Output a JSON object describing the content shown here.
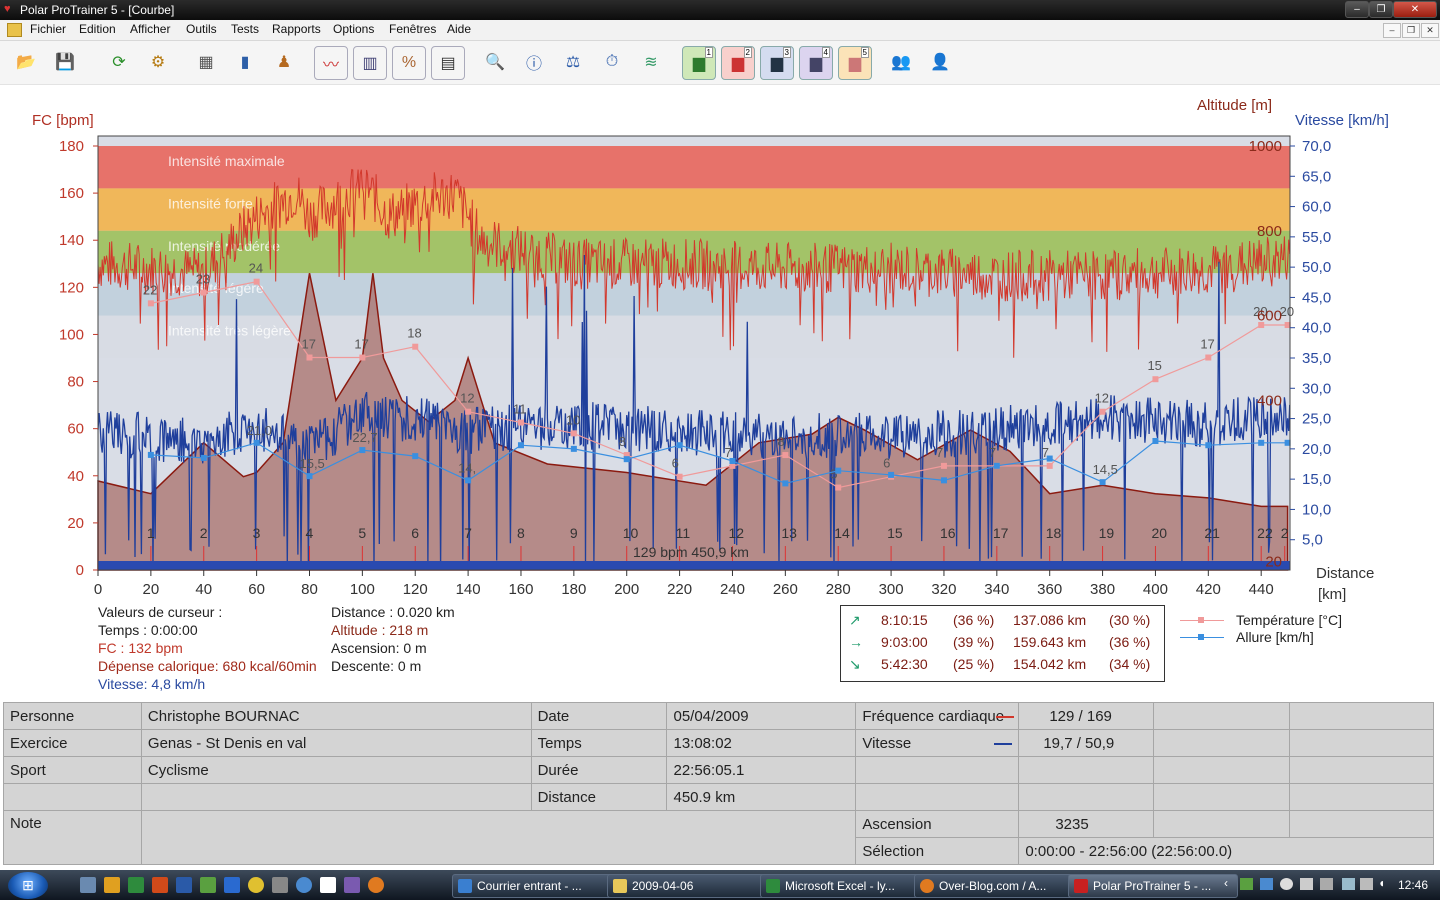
{
  "window": {
    "title": "Polar ProTrainer 5 - [Courbe]",
    "app_icon": "polar-heart-icon"
  },
  "menu": [
    "Fichier",
    "Edition",
    "Afficher",
    "Outils",
    "Tests",
    "Rapports",
    "Options",
    "Fenêtres",
    "Aide"
  ],
  "toolbar": {
    "buttons": [
      "open-folder-icon",
      "save-disk-icon",
      "sync-icon",
      "settings-gear-icon",
      "calendar-icon",
      "book-icon",
      "person-tip-icon",
      "line-chart-icon",
      "bar-chart-icon",
      "percent-chart-icon",
      "table-icon",
      "zoom-icon",
      "info-chart-icon",
      "weight-icon",
      "stopwatch-icon",
      "multi-line-icon",
      "chart-1-icon",
      "chart-2-icon",
      "chart-3-icon",
      "chart-4-icon",
      "chart-5-icon",
      "group-report-icon",
      "users-icon"
    ],
    "chart_numbers": [
      "1",
      "2",
      "3",
      "4",
      "5"
    ]
  },
  "chart_data": {
    "type": "line",
    "axes": {
      "left_label": "FC [bpm]",
      "left_ticks": [
        "0",
        "20",
        "40",
        "60",
        "80",
        "100",
        "120",
        "140",
        "160",
        "180"
      ],
      "right1_label": "Altitude  [m]",
      "right1_ticks": [
        "20",
        "400",
        "600",
        "800",
        "1000"
      ],
      "right2_label": "Vitesse [km/h]",
      "right2_ticks": [
        "5,0",
        "10,0",
        "15,0",
        "20,0",
        "25,0",
        "30,0",
        "35,0",
        "40,0",
        "45,0",
        "50,0",
        "55,0",
        "60,0",
        "65,0",
        "70,0"
      ],
      "x_label_line1": "Distance",
      "x_label_line2": "[km]",
      "x_ticks": [
        "0",
        "20",
        "40",
        "60",
        "80",
        "100",
        "120",
        "140",
        "160",
        "180",
        "200",
        "220",
        "240",
        "260",
        "280",
        "300",
        "320",
        "340",
        "360",
        "380",
        "400",
        "420",
        "440"
      ],
      "xlim": [
        0,
        450.9
      ],
      "ylim_hr": [
        0,
        180
      ],
      "ylim_speed": [
        0,
        70
      ],
      "ylim_alt": [
        0,
        1000
      ]
    },
    "zones": [
      {
        "label": "Intensité maximale",
        "from": 162,
        "to": 180,
        "color": "#e8665c"
      },
      {
        "label": "Intensité forte",
        "from": 144,
        "to": 162,
        "color": "#f2b24a"
      },
      {
        "label": "Intensité modérée",
        "from": 126,
        "to": 144,
        "color": "#9cc05a"
      },
      {
        "label": "Intensité légère",
        "from": 108,
        "to": 126,
        "color": "#bfcfdc"
      },
      {
        "label": "Intensité très légère",
        "from": 90,
        "to": 108,
        "color": "#d7dbe3"
      }
    ],
    "altitude": [
      [
        0,
        210
      ],
      [
        20,
        180
      ],
      [
        40,
        300
      ],
      [
        55,
        220
      ],
      [
        60,
        230
      ],
      [
        70,
        300
      ],
      [
        80,
        700
      ],
      [
        90,
        400
      ],
      [
        100,
        500
      ],
      [
        104,
        700
      ],
      [
        108,
        500
      ],
      [
        115,
        400
      ],
      [
        125,
        350
      ],
      [
        135,
        400
      ],
      [
        140,
        500
      ],
      [
        150,
        300
      ],
      [
        170,
        250
      ],
      [
        200,
        230
      ],
      [
        230,
        200
      ],
      [
        250,
        300
      ],
      [
        270,
        320
      ],
      [
        280,
        360
      ],
      [
        290,
        330
      ],
      [
        310,
        260
      ],
      [
        330,
        330
      ],
      [
        345,
        280
      ],
      [
        360,
        180
      ],
      [
        380,
        200
      ],
      [
        400,
        180
      ],
      [
        420,
        170
      ],
      [
        440,
        150
      ],
      [
        450,
        150
      ]
    ],
    "hr_mean": [
      [
        0,
        130
      ],
      [
        20,
        128
      ],
      [
        40,
        126
      ],
      [
        60,
        150
      ],
      [
        75,
        160
      ],
      [
        80,
        150
      ],
      [
        95,
        160
      ],
      [
        100,
        165
      ],
      [
        110,
        150
      ],
      [
        125,
        158
      ],
      [
        135,
        160
      ],
      [
        145,
        140
      ],
      [
        180,
        130
      ],
      [
        220,
        130
      ],
      [
        260,
        128
      ],
      [
        300,
        128
      ],
      [
        340,
        125
      ],
      [
        380,
        125
      ],
      [
        420,
        127
      ],
      [
        450,
        132
      ]
    ],
    "speed_mean": [
      [
        0,
        23
      ],
      [
        20,
        22
      ],
      [
        40,
        21
      ],
      [
        60,
        24
      ],
      [
        80,
        20
      ],
      [
        100,
        26
      ],
      [
        120,
        25
      ],
      [
        140,
        23
      ],
      [
        180,
        24
      ],
      [
        220,
        23
      ],
      [
        260,
        22
      ],
      [
        300,
        22
      ],
      [
        340,
        23
      ],
      [
        380,
        25
      ],
      [
        420,
        24
      ],
      [
        450,
        26
      ]
    ],
    "temperature": {
      "name": "Température [°C]",
      "x": [
        20,
        40,
        60,
        80,
        100,
        120,
        140,
        160,
        180,
        200,
        220,
        240,
        260,
        280,
        300,
        320,
        340,
        360,
        380,
        400,
        420,
        440,
        450
      ],
      "values": [
        22,
        23,
        24,
        17,
        17,
        18,
        12,
        11,
        10,
        8,
        6,
        7,
        8,
        5,
        6,
        7,
        7,
        7,
        12,
        15,
        17,
        20,
        20
      ]
    },
    "allure": {
      "name": "Allure [km/h]",
      "x": [
        20,
        40,
        60,
        80,
        100,
        120,
        140,
        160,
        180,
        200,
        220,
        240,
        260,
        280,
        300,
        320,
        340,
        360,
        380,
        400,
        420,
        440,
        450
      ],
      "values": [
        19.0,
        18.5,
        21.0,
        15.5,
        19.8,
        18.8,
        14.8,
        20.6,
        20.0,
        18.3,
        20.6,
        18.0,
        14.3,
        16.4,
        15.7,
        14.8,
        17.2,
        18.4,
        14.5,
        21.3,
        20.6,
        21.0,
        21.0
      ],
      "labels": [
        "",
        "",
        "21,0",
        "15,5",
        "22,7",
        "",
        "14,",
        "",
        "",
        "",
        "",
        "",
        "",
        "",
        "",
        "",
        "",
        "",
        "14,5",
        "",
        "",
        "",
        ""
      ]
    },
    "laps": [
      "1",
      "2",
      "3",
      "4",
      "5",
      "6",
      "7",
      "8",
      "9",
      "10",
      "11",
      "12",
      "13",
      "14",
      "15",
      "16",
      "17",
      "18",
      "19",
      "20",
      "21",
      "22",
      "2"
    ],
    "summary_label": "129 bpm 450,9 km",
    "colors": {
      "hr": "#d2382c",
      "speed": "#1f3f9c",
      "altitude_fill": "#a86f6a",
      "temperature": "#f09a9a",
      "allure": "#3a8fe0"
    }
  },
  "cursor": {
    "title": "Valeurs de curseur :",
    "time": "Temps : 0:00:00",
    "hr": "FC : 132 bpm",
    "calories": "Dépense calorique: 680 kcal/60min",
    "speed": "Vitesse: 4,8 km/h",
    "distance": "Distance : 0.020 km",
    "altitude": "Altitude : 218 m",
    "ascent": "Ascension: 0 m",
    "descent": "Descente: 0 m"
  },
  "slopes": [
    {
      "icon": "arrow-up-icon",
      "time": "8:10:15",
      "pct": "(36 %)",
      "dist": "137.086 km",
      "dpct": "(30 %)"
    },
    {
      "icon": "arrow-right-icon",
      "time": "9:03:00",
      "pct": "(39 %)",
      "dist": "159.643 km",
      "dpct": "(36 %)"
    },
    {
      "icon": "arrow-down-icon",
      "time": "5:42:30",
      "pct": "(25 %)",
      "dist": "154.042 km",
      "dpct": "(34 %)"
    }
  ],
  "legend": {
    "temperature": "Température [°C]",
    "allure": "Allure [km/h]"
  },
  "info": {
    "person_label": "Personne",
    "person": "Christophe BOURNAC",
    "exercise_label": "Exercice",
    "exercise": "Genas - St Denis en val",
    "sport_label": "Sport",
    "sport": "Cyclisme",
    "note_label": "Note",
    "date_label": "Date",
    "date": "05/04/2009",
    "time_label": "Temps",
    "time": "13:08:02",
    "duration_label": "Durée",
    "duration": "22:56:05.1",
    "distance_label": "Distance",
    "distance": "450.9 km",
    "hr_label": "Fréquence cardiaque",
    "hr": "129 / 169",
    "speed_label": "Vitesse",
    "speed": "19,7 / 50,9",
    "ascent_label": "Ascension",
    "ascent": "3235",
    "selection_label": "Sélection",
    "selection": "0:00:00 - 22:56:00 (22:56:00.0)"
  },
  "taskbar": {
    "tasks": [
      {
        "label": "Courrier entrant - ...",
        "icon": "mail-icon",
        "color": "#3a7fd0"
      },
      {
        "label": "2009-04-06",
        "icon": "folder-icon",
        "color": "#e8c85a"
      },
      {
        "label": "Microsoft Excel - ly...",
        "icon": "excel-icon",
        "color": "#2e8b3d"
      },
      {
        "label": "Over-Blog.com / A...",
        "icon": "firefox-icon",
        "color": "#e07a20"
      },
      {
        "label": "Polar ProTrainer 5 - ...",
        "icon": "polar-heart-icon",
        "color": "#c82020"
      }
    ],
    "clock": "12:46"
  }
}
